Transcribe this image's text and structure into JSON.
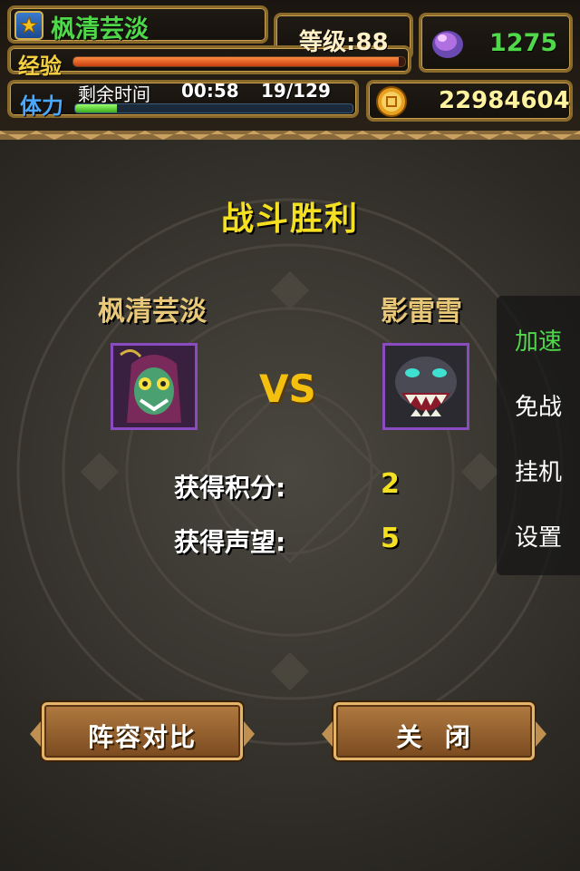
{
  "hud": {
    "player_name": "枫清芸淡",
    "level_label": "等级:88",
    "gems": "1275",
    "exp_label": "经验",
    "exp_progress": 0.98,
    "stamina_label": "体力",
    "stamina_time_label": "剩余时间",
    "stamina_time": "00:58",
    "stamina_count": "19/129",
    "stamina_progress": 0.15,
    "coins": "22984604"
  },
  "battle": {
    "title": "战斗胜利",
    "player_left": "枫清芸淡",
    "player_right": "影雷雪",
    "vs": "VS",
    "score_label": "获得积分:",
    "score_value": "2",
    "prestige_label": "获得声望:",
    "prestige_value": "5"
  },
  "side_menu": {
    "items": [
      {
        "label": "加速"
      },
      {
        "label": "免战"
      },
      {
        "label": "挂机"
      },
      {
        "label": "设置"
      }
    ]
  },
  "buttons": {
    "compare": "阵容对比",
    "close": "关  闭"
  },
  "colors": {
    "accent_green": "#4fd84a",
    "title_yellow": "#f4e020"
  }
}
